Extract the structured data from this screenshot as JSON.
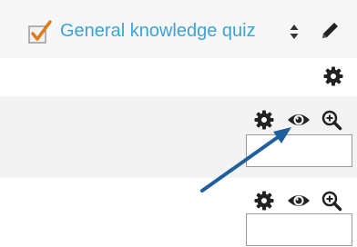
{
  "quiz": {
    "title": "General knowledge quiz",
    "title_color": "#3aa3d9",
    "icon": "quiz-checkbox-icon"
  },
  "header_actions": [
    "sort-icon",
    "edit-icon"
  ],
  "settings_icon": "gear-icon",
  "question_rows": [
    {
      "actions": [
        "gear-icon",
        "eye-icon",
        "zoom-in-icon"
      ],
      "input_value": ""
    },
    {
      "actions": [
        "gear-icon",
        "eye-icon",
        "zoom-in-icon"
      ],
      "input_value": ""
    }
  ],
  "colors": {
    "accent": "#3aa3d9",
    "arrow": "#1f5f9e",
    "check": "#e07b1a",
    "icon": "#222222"
  }
}
